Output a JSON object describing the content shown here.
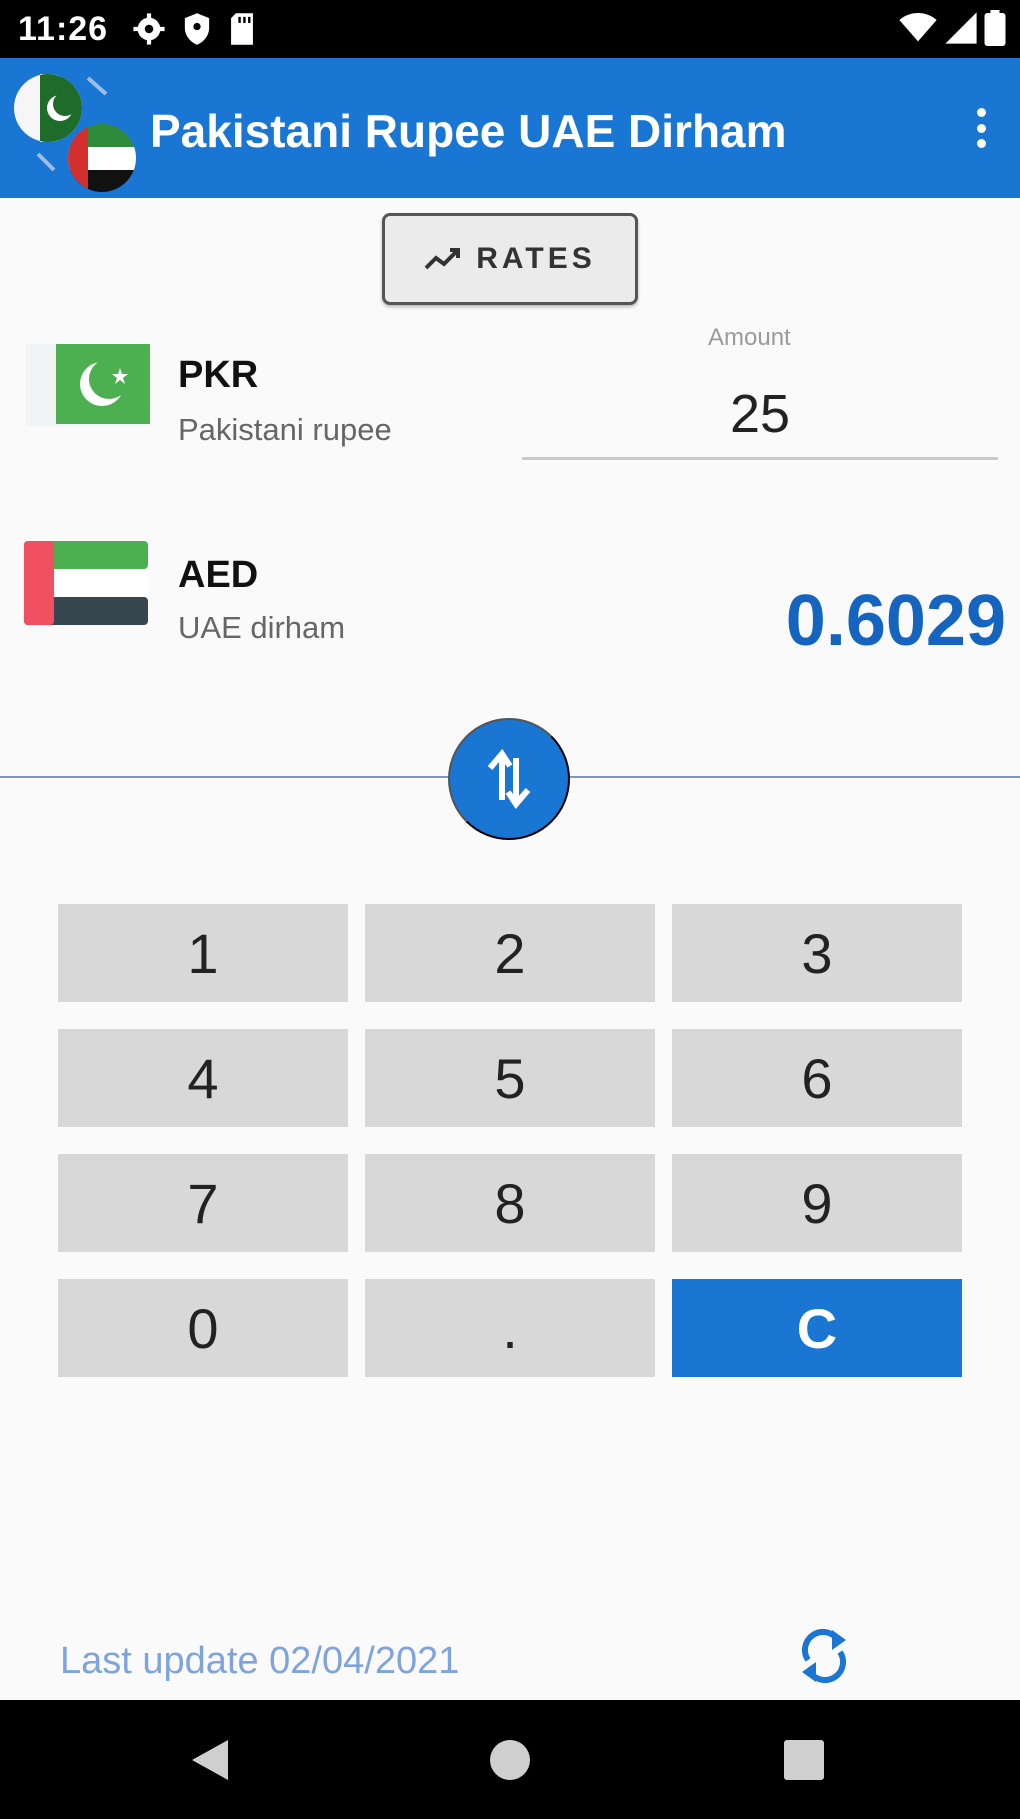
{
  "status_bar": {
    "time": "11:26",
    "left_icons": [
      "settings-icon",
      "shield-icon",
      "sd-card-icon"
    ],
    "right_icons": [
      "wifi-icon",
      "signal-icon",
      "battery-icon"
    ]
  },
  "app_bar": {
    "title": "Pakistani Rupee UAE Dirham",
    "logo": "pk-ae-swap-logo",
    "menu_icon": "overflow-menu-icon"
  },
  "rates_button": {
    "label": "RATES",
    "icon": "trend-chart-icon"
  },
  "from_currency": {
    "code": "PKR",
    "name": "Pakistani rupee",
    "flag": "pakistan-flag",
    "amount_label": "Amount",
    "amount_value": "25"
  },
  "to_currency": {
    "code": "AED",
    "name": "UAE dirham",
    "flag": "uae-flag",
    "result": "0.6029"
  },
  "swap_icon": "swap-arrows-icon",
  "keypad": {
    "keys": [
      "1",
      "2",
      "3",
      "4",
      "5",
      "6",
      "7",
      "8",
      "9",
      "0",
      ".",
      "C"
    ]
  },
  "footer": {
    "last_update": "Last update 02/04/2021",
    "refresh_icon": "refresh-icon"
  },
  "nav_bar": {
    "icons": [
      "back-icon",
      "home-icon",
      "recents-icon"
    ]
  },
  "colors": {
    "primary": "#1976d2",
    "result_text": "#1565c0",
    "key_background": "#d8d8d8",
    "footer_text": "#7fa3dd"
  }
}
